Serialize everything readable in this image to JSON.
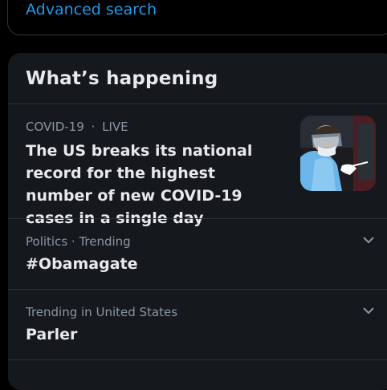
{
  "top": {
    "advanced_search": "Advanced search"
  },
  "panel": {
    "title": "What’s happening",
    "trends": [
      {
        "category": "COVID-19",
        "separator": "·",
        "status": "LIVE",
        "headline": "The US breaks its national record for the highest number of new COVID-19 cases in a single day",
        "has_thumbnail": true
      },
      {
        "meta": "Politics · Trending",
        "title": "#Obamagate"
      },
      {
        "meta": "Trending in United States",
        "title": "Parler"
      }
    ]
  },
  "colors": {
    "background": "#000000",
    "panel": "#15181c",
    "accent": "#1d9bf0",
    "text_primary": "#e7e9ea",
    "text_secondary": "#8b98a5",
    "divider": "#2f3336"
  },
  "icons": {
    "more": "chevron-down-icon"
  }
}
